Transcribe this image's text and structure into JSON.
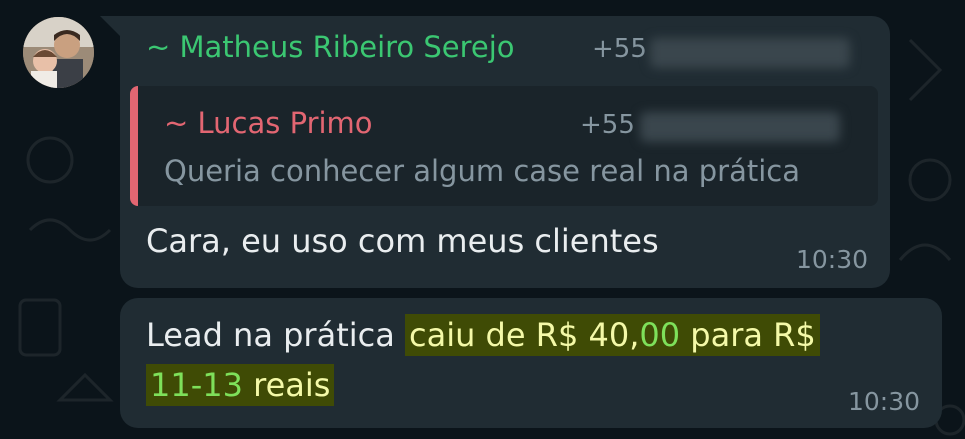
{
  "chat": {
    "avatar_alt": "avatar",
    "message1": {
      "sender_name": "~ Matheus Ribeiro Serejo",
      "sender_phone_prefix": "+55",
      "quoted": {
        "sender_name": "~ Lucas Primo",
        "sender_phone_prefix": "+55",
        "text": "Queria conhecer algum case real na prática"
      },
      "text": "Cara, eu uso com meus clientes",
      "time": "10:30"
    },
    "message2": {
      "text_plain": "Lead na prática ",
      "text_hl_1": "caiu de R$ 40,",
      "text_hl_2": "00",
      "text_hl_3": " para R$ ",
      "text_hl_4": "11-13",
      "text_hl_5": " reais",
      "time": "10:30"
    }
  },
  "colors": {
    "background": "#0b141a",
    "bubble": "#202c33",
    "sender_name": "#3bc772",
    "quote_accent": "#e26672",
    "highlight_bg": "#3f4b05",
    "highlight_text": "#f4f9a8",
    "highlight_number": "#7ee05a"
  }
}
